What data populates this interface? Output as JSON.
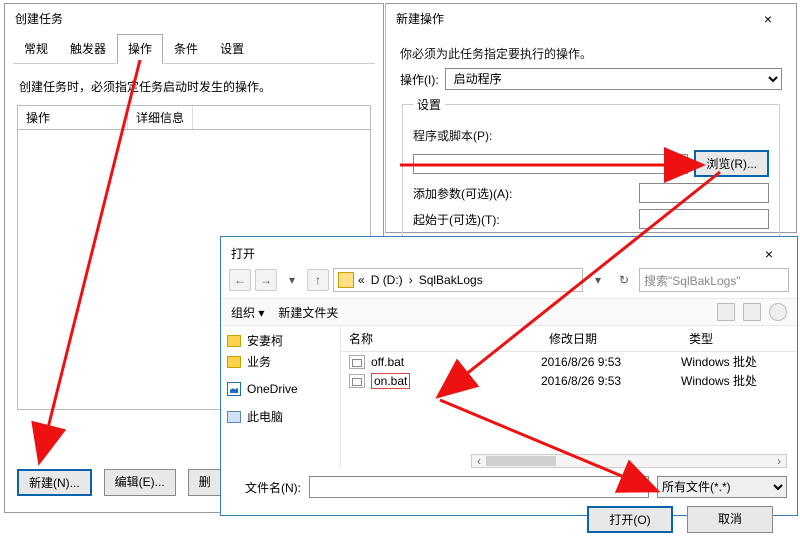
{
  "create_task": {
    "title": "创建任务",
    "tabs": [
      "常规",
      "触发器",
      "操作",
      "条件",
      "设置"
    ],
    "active_tab_index": 2,
    "desc": "创建任务时，必须指定任务启动时发生的操作。",
    "col_action": "操作",
    "col_detail": "详细信息",
    "btn_new": "新建(N)...",
    "btn_edit": "编辑(E)...",
    "btn_delete_prefix": "删"
  },
  "new_action": {
    "title": "新建操作",
    "close": "×",
    "desc": "你必须为此任务指定要执行的操作。",
    "action_label": "操作(I):",
    "action_value": "启动程序",
    "group": "设置",
    "program_label": "程序或脚本(P):",
    "browse": "浏览(R)...",
    "args_label": "添加参数(可选)(A):",
    "startin_label": "起始于(可选)(T):"
  },
  "open_dialog": {
    "title": "打开",
    "close": "×",
    "nav_back": "←",
    "nav_fwd": "→",
    "nav_up": "↑",
    "crumbs": [
      "«",
      "D (D:)",
      "›",
      "SqlBakLogs"
    ],
    "refresh": "↻",
    "search_placeholder": "搜索\"SqlBakLogs\"",
    "org": "组织 ▾",
    "newfolder": "新建文件夹",
    "tree": [
      {
        "icon": "folder",
        "label": "安妻柯"
      },
      {
        "icon": "folder",
        "label": "业务"
      },
      {
        "icon": "onedrive",
        "label": "OneDrive"
      },
      {
        "icon": "pc",
        "label": "此电脑"
      }
    ],
    "hdr_name": "名称",
    "hdr_date": "修改日期",
    "hdr_type": "类型",
    "rows": [
      {
        "name": "off.bat",
        "date": "2016/8/26 9:53",
        "type": "Windows 批处",
        "selected": false
      },
      {
        "name": "on.bat",
        "date": "2016/8/26 9:53",
        "type": "Windows 批处",
        "selected": true
      }
    ],
    "filename_label": "文件名(N):",
    "filename_value": "",
    "filter": "所有文件(*.*)",
    "open_btn": "打开(O)",
    "cancel_btn": "取消"
  }
}
